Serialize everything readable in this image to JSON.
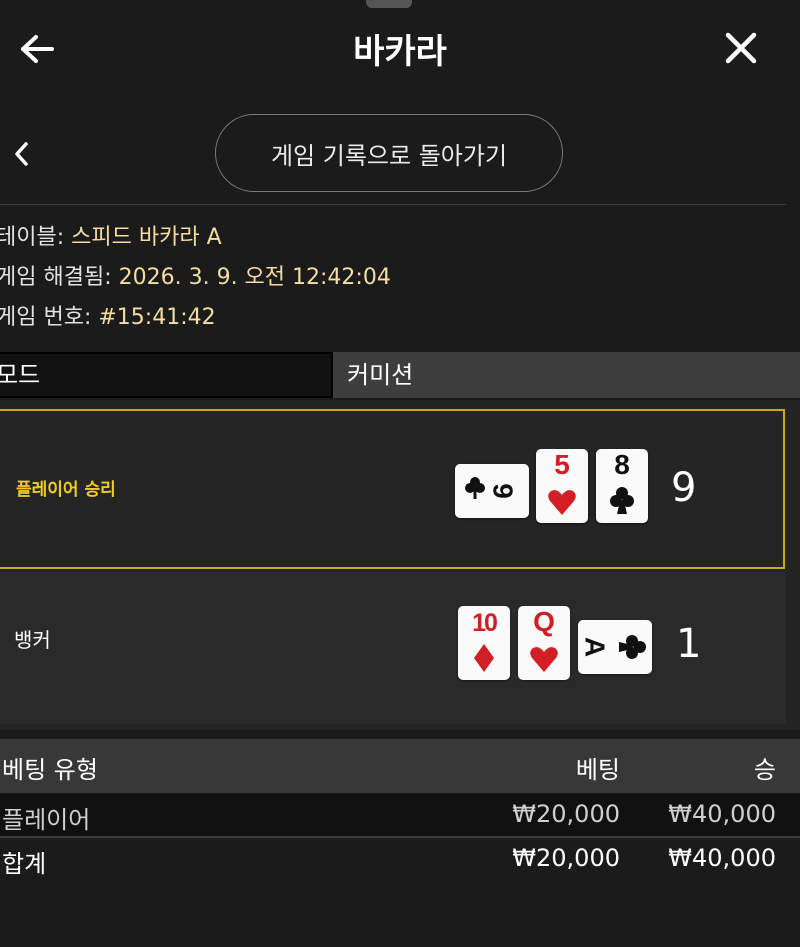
{
  "header": {
    "title": "바카라",
    "back_icon": "arrow-left-icon",
    "close_icon": "close-icon"
  },
  "nav": {
    "prev_icon": "chevron-left-icon",
    "back_button_label": "게임 기록으로 돌아가기"
  },
  "info": {
    "table_label": "테이블:",
    "table_value": "스피드 바카라 A",
    "resolved_label": "게임 해결됨:",
    "resolved_value": "2026. 3. 9. 오전 12:42:04",
    "game_no_label": "게임 번호:",
    "game_no_value": "#15:41:42"
  },
  "mode": {
    "mode_label": "모드",
    "mode_value": "커미션"
  },
  "results": {
    "player": {
      "label": "플레이어 승리",
      "score": "9",
      "cards": [
        {
          "rank": "9",
          "suit": "clubs",
          "orientation": "sideways"
        },
        {
          "rank": "5",
          "suit": "hearts",
          "orientation": "upright"
        },
        {
          "rank": "8",
          "suit": "clubs",
          "orientation": "upright"
        }
      ]
    },
    "banker": {
      "label": "뱅커",
      "score": "1",
      "cards": [
        {
          "rank": "10",
          "suit": "diamonds",
          "orientation": "upright"
        },
        {
          "rank": "Q",
          "suit": "hearts",
          "orientation": "upright"
        },
        {
          "rank": "A",
          "suit": "clubs",
          "orientation": "sideways"
        }
      ]
    }
  },
  "bets": {
    "columns": [
      "베팅 유형",
      "베팅",
      "승"
    ],
    "rows": [
      {
        "type": "플레이어",
        "bet": "₩20,000",
        "win": "₩40,000"
      },
      {
        "type": "합계",
        "bet": "₩20,000",
        "win": "₩40,000"
      }
    ]
  },
  "colors": {
    "background": "#1b1b1b",
    "accent_gold": "#f2cc24",
    "winner_border": "#c9a917",
    "red_suit": "#d21f26",
    "black_suit": "#111111"
  }
}
